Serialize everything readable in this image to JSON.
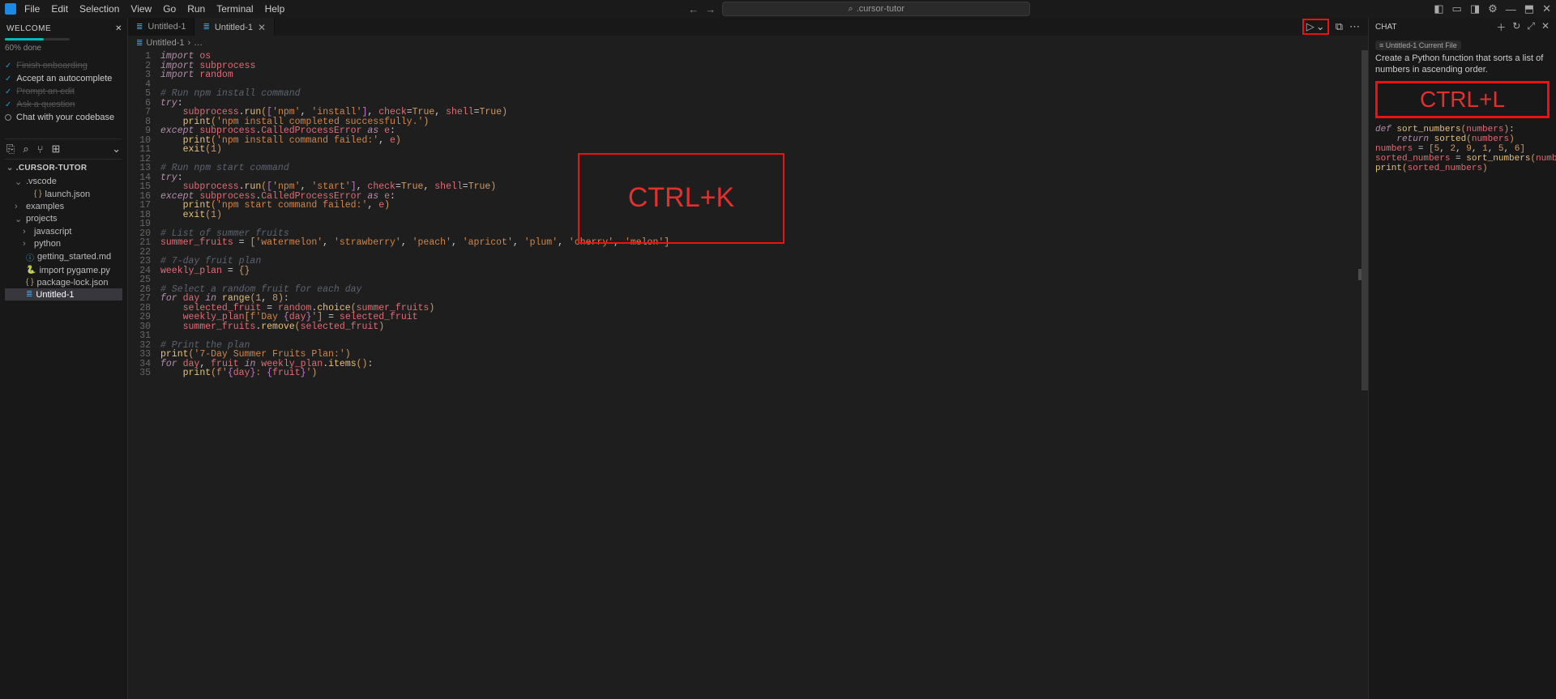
{
  "menu": {
    "file": "File",
    "edit": "Edit",
    "selection": "Selection",
    "view": "View",
    "go": "Go",
    "run": "Run",
    "terminal": "Terminal",
    "help": "Help"
  },
  "command_center": {
    "text": ".cursor-tutor"
  },
  "title_right_icons": [
    {
      "name": "layout-panel-left",
      "glyph": "◧"
    },
    {
      "name": "layout-bottom",
      "glyph": "▭"
    },
    {
      "name": "layout-panel-right",
      "glyph": "◨"
    },
    {
      "name": "settings-gear",
      "glyph": "⚙"
    },
    {
      "name": "minimize",
      "glyph": "—"
    },
    {
      "name": "maximize",
      "glyph": "⬒"
    },
    {
      "name": "close",
      "glyph": "✕"
    }
  ],
  "welcome": {
    "title": "WELCOME",
    "progress": "60% done",
    "items": [
      {
        "label": "Finish onboarding",
        "done": true,
        "icon": "check"
      },
      {
        "label": "Accept an autocomplete",
        "done": false,
        "icon": "check"
      },
      {
        "label": "Prompt an edit",
        "done": true,
        "icon": "check"
      },
      {
        "label": "Ask a question",
        "done": true,
        "icon": "check"
      },
      {
        "label": "Chat with your codebase",
        "done": false,
        "icon": "circle"
      }
    ]
  },
  "explorer_icons": [
    {
      "name": "new-file",
      "glyph": "⎘"
    },
    {
      "name": "search",
      "glyph": "⌕"
    },
    {
      "name": "branch",
      "glyph": "⑂"
    },
    {
      "name": "extensions",
      "glyph": "⊞"
    },
    {
      "name": "chevron-down",
      "glyph": "⌄"
    }
  ],
  "tree": {
    "root": ".CURSOR-TUTOR",
    "rows": [
      {
        "indent": 1,
        "tw": "⌄",
        "icon": "folder",
        "label": ".vscode"
      },
      {
        "indent": 2,
        "tw": "",
        "icon": "json",
        "label": "launch.json"
      },
      {
        "indent": 1,
        "tw": "›",
        "icon": "folder",
        "label": "examples"
      },
      {
        "indent": 1,
        "tw": "⌄",
        "icon": "folder",
        "label": "projects"
      },
      {
        "indent": 2,
        "tw": "›",
        "icon": "folder",
        "label": "javascript"
      },
      {
        "indent": 2,
        "tw": "›",
        "icon": "folder",
        "label": "python"
      },
      {
        "indent": 1,
        "tw": "",
        "icon": "md",
        "label": "getting_started.md"
      },
      {
        "indent": 1,
        "tw": "",
        "icon": "py",
        "label": "import pygame.py"
      },
      {
        "indent": 1,
        "tw": "",
        "icon": "json",
        "label": "package-lock.json"
      },
      {
        "indent": 1,
        "tw": "",
        "icon": "untitled",
        "label": "Untitled-1",
        "selected": true
      }
    ]
  },
  "tabs": [
    {
      "label": "Untitled-1",
      "active": false,
      "closeable": false
    },
    {
      "label": "Untitled-1",
      "active": true,
      "closeable": true
    }
  ],
  "tab_controls": [
    {
      "name": "run",
      "glyph": "▷",
      "boxed": true
    },
    {
      "name": "run-chevron",
      "glyph": "⌄",
      "boxed": true
    },
    {
      "name": "split-editor",
      "glyph": "⧉"
    },
    {
      "name": "more",
      "glyph": "⋯"
    }
  ],
  "breadcrumb": {
    "file": "Untitled-1",
    "sep": "›",
    "rest": "…"
  },
  "code_lines": [
    {
      "n": 1,
      "html": "<span class='k'>import</span> <span class='id'>os</span>"
    },
    {
      "n": 2,
      "html": "<span class='k'>import</span> <span class='id'>subprocess</span>"
    },
    {
      "n": 3,
      "html": "<span class='k'>import</span> <span class='id'>random</span>"
    },
    {
      "n": 4,
      "html": ""
    },
    {
      "n": 5,
      "html": "<span class='cm'># Run npm install command</span>"
    },
    {
      "n": 6,
      "html": "<span class='k'>try</span><span class='p'>:</span>"
    },
    {
      "n": 7,
      "html": "    <span class='obj'>subprocess</span><span class='p'>.</span><span class='fn'>run</span><span class='br'>(</span><span class='br2'>[</span><span class='s'>'npm'</span><span class='p'>, </span><span class='s'>'install'</span><span class='br2'>]</span><span class='p'>, </span><span class='ar'>check</span><span class='p'>=</span><span class='bl'>True</span><span class='p'>, </span><span class='ar'>shell</span><span class='p'>=</span><span class='bl'>True</span><span class='br'>)</span>"
    },
    {
      "n": 8,
      "html": "    <span class='fn'>print</span><span class='br'>(</span><span class='s'>'npm install completed successfully.'</span><span class='br'>)</span>"
    },
    {
      "n": 9,
      "html": "<span class='k'>except</span> <span class='obj'>subprocess</span><span class='p'>.</span><span class='id'>CalledProcessError</span> <span class='k'>as</span> <span class='id'>e</span><span class='p'>:</span>"
    },
    {
      "n": 10,
      "html": "    <span class='fn'>print</span><span class='br'>(</span><span class='s'>'npm install command failed:'</span><span class='p'>, </span><span class='id'>e</span><span class='br'>)</span>"
    },
    {
      "n": 11,
      "html": "    <span class='fn'>exit</span><span class='br'>(</span><span class='nm'>1</span><span class='br'>)</span>"
    },
    {
      "n": 12,
      "html": ""
    },
    {
      "n": 13,
      "html": "<span class='cm'># Run npm start command</span>"
    },
    {
      "n": 14,
      "html": "<span class='k'>try</span><span class='p'>:</span>"
    },
    {
      "n": 15,
      "html": "    <span class='obj'>subprocess</span><span class='p'>.</span><span class='fn'>run</span><span class='br'>(</span><span class='br2'>[</span><span class='s'>'npm'</span><span class='p'>, </span><span class='s'>'start'</span><span class='br2'>]</span><span class='p'>, </span><span class='ar'>check</span><span class='p'>=</span><span class='bl'>True</span><span class='p'>, </span><span class='ar'>shell</span><span class='p'>=</span><span class='bl'>True</span><span class='br'>)</span>"
    },
    {
      "n": 16,
      "html": "<span class='k'>except</span> <span class='obj'>subprocess</span><span class='p'>.</span><span class='id'>CalledProcessError</span> <span class='k'>as</span> <span class='id'>e</span><span class='p'>:</span>"
    },
    {
      "n": 17,
      "html": "    <span class='fn'>print</span><span class='br'>(</span><span class='s'>'npm start command failed:'</span><span class='p'>, </span><span class='id'>e</span><span class='br'>)</span>"
    },
    {
      "n": 18,
      "html": "    <span class='fn'>exit</span><span class='br'>(</span><span class='nm'>1</span><span class='br'>)</span>"
    },
    {
      "n": 19,
      "html": ""
    },
    {
      "n": 20,
      "html": "<span class='cm'># List of summer fruits</span>"
    },
    {
      "n": 21,
      "html": "<span class='id'>summer_fruits</span> <span class='p'>=</span> <span class='br'>[</span><span class='s'>'watermelon'</span><span class='p'>, </span><span class='s'>'strawberry'</span><span class='p'>, </span><span class='s'>'peach'</span><span class='p'>, </span><span class='s'>'apricot'</span><span class='p'>, </span><span class='s'>'plum'</span><span class='p'>, </span><span class='s'>'cherry'</span><span class='p'>, </span><span class='s'>'melon'</span><span class='br'>]</span>"
    },
    {
      "n": 22,
      "html": ""
    },
    {
      "n": 23,
      "html": "<span class='cm'># 7-day fruit plan</span>"
    },
    {
      "n": 24,
      "html": "<span class='id'>weekly_plan</span> <span class='p'>=</span> <span class='br'>{}</span>"
    },
    {
      "n": 25,
      "html": ""
    },
    {
      "n": 26,
      "html": "<span class='cm'># Select a random fruit for each day</span>"
    },
    {
      "n": 27,
      "html": "<span class='k'>for</span> <span class='id'>day</span> <span class='k'>in</span> <span class='fn'>range</span><span class='br'>(</span><span class='nm'>1</span><span class='p'>, </span><span class='nm'>8</span><span class='br'>)</span><span class='p'>:</span>"
    },
    {
      "n": 28,
      "html": "    <span class='id'>selected_fruit</span> <span class='p'>=</span> <span class='obj'>random</span><span class='p'>.</span><span class='fn'>choice</span><span class='br'>(</span><span class='id'>summer_fruits</span><span class='br'>)</span>"
    },
    {
      "n": 29,
      "html": "    <span class='id'>weekly_plan</span><span class='br'>[</span><span class='s'>f'Day </span><span class='br2'>{</span><span class='id'>day</span><span class='br2'>}</span><span class='s'>'</span><span class='br'>]</span> <span class='p'>=</span> <span class='id'>selected_fruit</span>"
    },
    {
      "n": 30,
      "html": "    <span class='obj'>summer_fruits</span><span class='p'>.</span><span class='fn'>remove</span><span class='br'>(</span><span class='id'>selected_fruit</span><span class='br'>)</span>"
    },
    {
      "n": 31,
      "html": ""
    },
    {
      "n": 32,
      "html": "<span class='cm'># Print the plan</span>"
    },
    {
      "n": 33,
      "html": "<span class='fn'>print</span><span class='br'>(</span><span class='s'>'7-Day Summer Fruits Plan:'</span><span class='br'>)</span>"
    },
    {
      "n": 34,
      "html": "<span class='k'>for</span> <span class='id'>day</span><span class='p'>, </span><span class='id'>fruit</span> <span class='k'>in</span> <span class='obj'>weekly_plan</span><span class='p'>.</span><span class='fn'>items</span><span class='br'>()</span><span class='p'>:</span>"
    },
    {
      "n": 35,
      "html": "    <span class='fn'>print</span><span class='br'>(</span><span class='s'>f'</span><span class='br2'>{</span><span class='id'>day</span><span class='br2'>}</span><span class='s'>: </span><span class='br2'>{</span><span class='id'>fruit</span><span class='br2'>}</span><span class='s'>'</span><span class='br'>)</span>"
    }
  ],
  "overlay_k": "CTRL+K",
  "overlay_l": "CTRL+L",
  "chat": {
    "title": "CHAT",
    "icons": [
      {
        "name": "plus",
        "glyph": "＋"
      },
      {
        "name": "history",
        "glyph": "↻"
      },
      {
        "name": "expand",
        "glyph": "⤢"
      },
      {
        "name": "close",
        "glyph": "✕"
      }
    ],
    "tag": "≡ Untitled-1  Current File",
    "prompt": "Create a Python function that sorts a list of numbers in ascending order.",
    "code_lines": [
      "<span class='ck'>def</span> <span class='cfn'>sort_numbers</span><span class='cbr'>(</span><span class='cid'>numbers</span><span class='cbr'>)</span><span class='cpar'>:</span>",
      "    <span class='ck'>return</span> <span class='cfn'>sorted</span><span class='cbr'>(</span><span class='cid'>numbers</span><span class='cbr'>)</span>",
      "",
      "",
      "<span class='cid'>numbers</span> <span class='cpar'>=</span> <span class='cbr'>[</span><span class='cnm'>5</span><span class='cpar'>, </span><span class='cnm'>2</span><span class='cpar'>, </span><span class='cnm'>9</span><span class='cpar'>, </span><span class='cnm'>1</span><span class='cpar'>, </span><span class='cnm'>5</span><span class='cpar'>, </span><span class='cnm'>6</span><span class='cbr'>]</span>",
      "<span class='cid'>sorted_numbers</span> <span class='cpar'>=</span> <span class='cfn'>sort_numbers</span><span class='cbr'>(</span><span class='cid'>numbers</span><span class='cbr'>)</span>",
      "<span class='cfn'>print</span><span class='cbr'>(</span><span class='cid'>sorted_numbers</span><span class='cbr'>)</span>"
    ]
  }
}
